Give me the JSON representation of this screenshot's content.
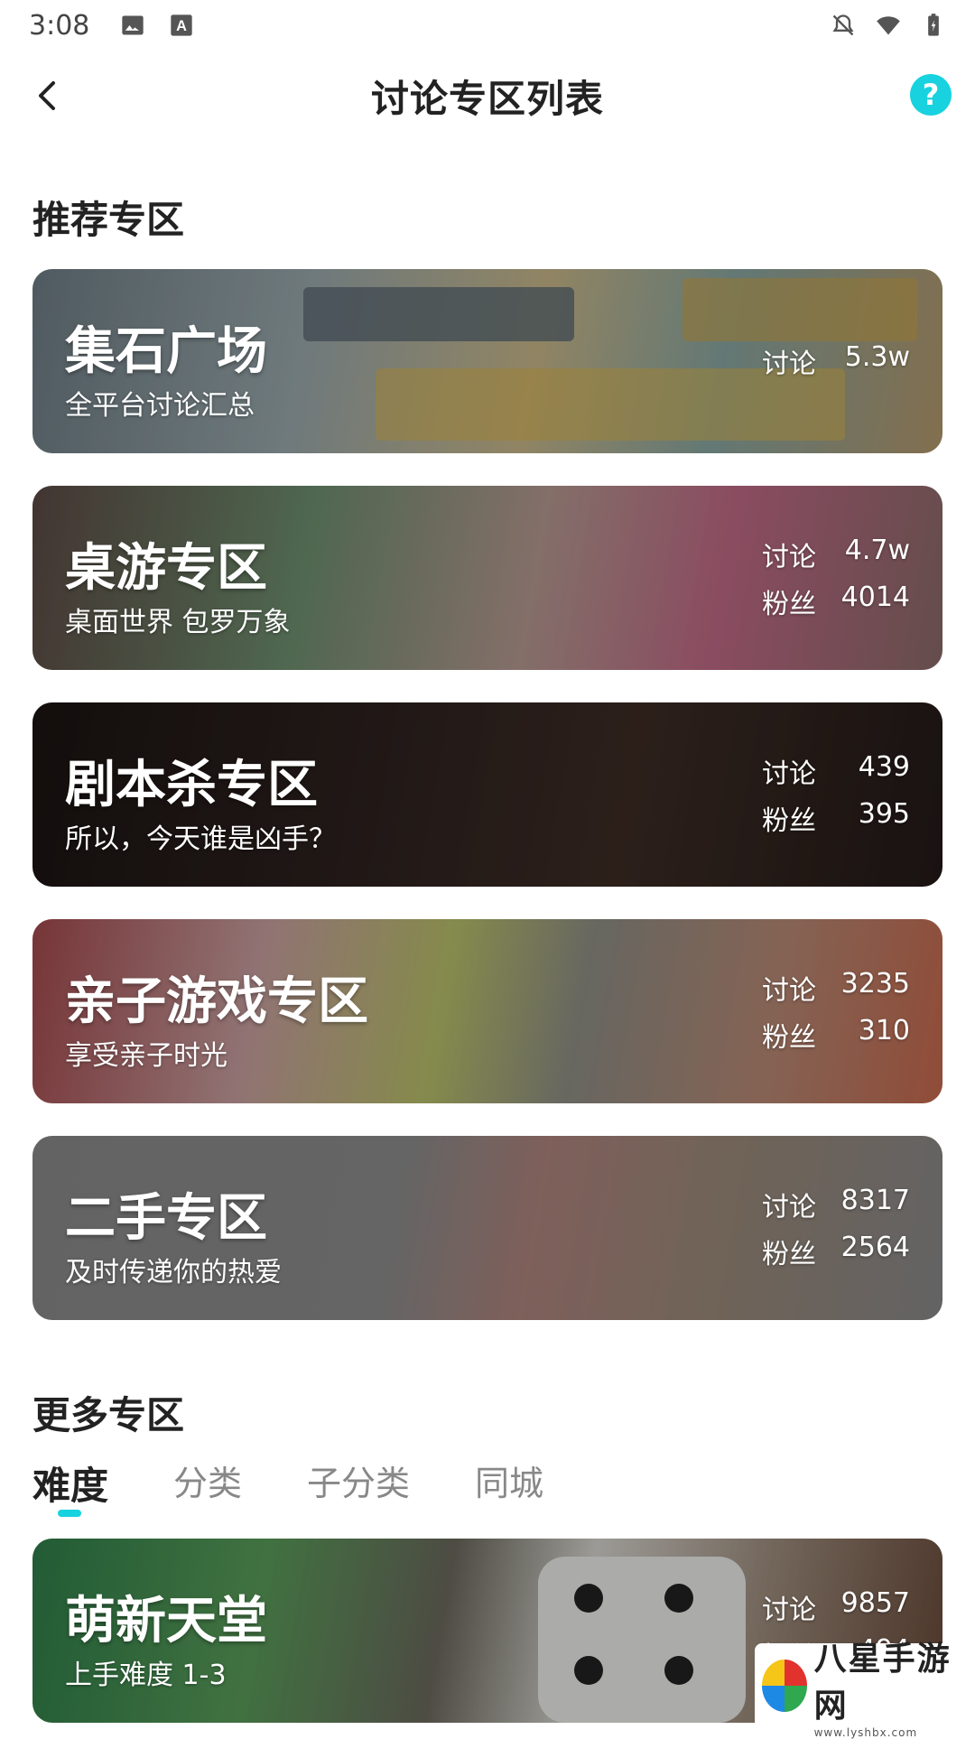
{
  "status_bar": {
    "time": "3:08",
    "icons_left": [
      "image-icon",
      "font-icon"
    ],
    "icons_right": [
      "bell-off-icon",
      "wifi-icon",
      "battery-icon"
    ]
  },
  "header": {
    "title": "讨论专区列表",
    "back_icon": "chevron-left-icon",
    "help_icon": "help-icon",
    "help_symbol": "?"
  },
  "recommended": {
    "title": "推荐专区",
    "cards": [
      {
        "title": "集石广场",
        "subtitle": "全平台讨论汇总",
        "stats": [
          {
            "label": "讨论",
            "value": "5.3w"
          }
        ]
      },
      {
        "title": "桌游专区",
        "subtitle": "桌面世界 包罗万象",
        "stats": [
          {
            "label": "讨论",
            "value": "4.7w"
          },
          {
            "label": "粉丝",
            "value": "4014"
          }
        ]
      },
      {
        "title": "剧本杀专区",
        "subtitle": "所以，今天谁是凶手？",
        "stats": [
          {
            "label": "讨论",
            "value": "439"
          },
          {
            "label": "粉丝",
            "value": "395"
          }
        ]
      },
      {
        "title": "亲子游戏专区",
        "subtitle": "享受亲子时光",
        "stats": [
          {
            "label": "讨论",
            "value": "3235"
          },
          {
            "label": "粉丝",
            "value": "310"
          }
        ]
      },
      {
        "title": "二手专区",
        "subtitle": "及时传递你的热爱",
        "stats": [
          {
            "label": "讨论",
            "value": "8317"
          },
          {
            "label": "粉丝",
            "value": "2564"
          }
        ]
      }
    ]
  },
  "more": {
    "title": "更多专区",
    "tabs": [
      "难度",
      "分类",
      "子分类",
      "同城"
    ],
    "active_tab": "难度",
    "cards": [
      {
        "title": "萌新天堂",
        "subtitle": "上手难度 1-3",
        "stats": [
          {
            "label": "讨论",
            "value": "9857"
          },
          {
            "label": "粉丝",
            "value": "494"
          }
        ]
      }
    ]
  },
  "watermark": {
    "title": "八星手游网",
    "url": "www.lyshbx.com"
  },
  "colors": {
    "accent": "#18d2df",
    "text": "#222222",
    "muted": "#888888"
  }
}
